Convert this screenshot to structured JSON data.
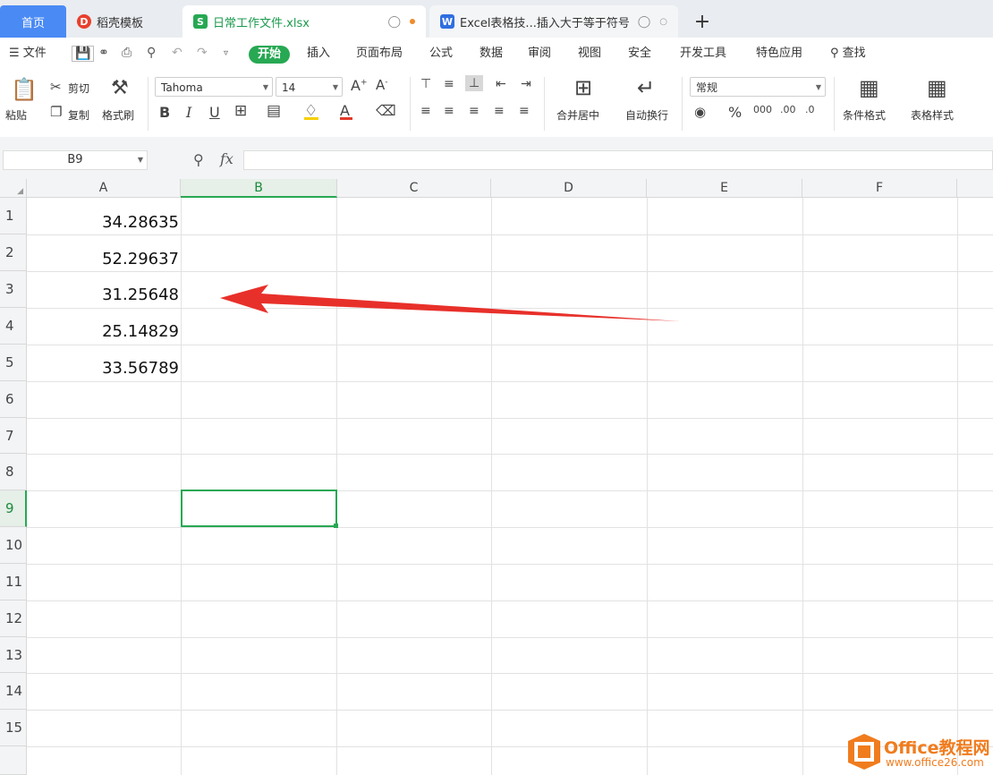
{
  "tabs": {
    "home": "首页",
    "templates": "稻壳模板",
    "doc1": "日常工作文件.xlsx",
    "doc2": "Excel表格技...插入大于等于符号",
    "add": "+"
  },
  "menu": {
    "file": "文件",
    "items": [
      "开始",
      "插入",
      "页面布局",
      "公式",
      "数据",
      "审阅",
      "视图",
      "安全",
      "开发工具",
      "特色应用"
    ],
    "search": "查找"
  },
  "ribbon": {
    "paste": "粘贴",
    "cut": "剪切",
    "copy": "复制",
    "format_painter": "格式刷",
    "font_name": "Tahoma",
    "font_size": "14",
    "merge_center": "合并居中",
    "wrap_text": "自动换行",
    "number_format": "常规",
    "cond_format": "条件格式",
    "table_style": "表格样式"
  },
  "formula_bar": {
    "name_box": "B9",
    "fx": "fx",
    "value": ""
  },
  "sheet": {
    "columns": [
      "A",
      "B",
      "C",
      "D",
      "E",
      "F"
    ],
    "selected_column": "B",
    "rows": [
      "1",
      "2",
      "3",
      "4",
      "5",
      "6",
      "7",
      "8",
      "9",
      "10",
      "11",
      "12",
      "13",
      "14",
      "15"
    ],
    "selected_row": "9",
    "column_a_values": [
      "34.28635",
      "52.29637",
      "31.25648",
      "25.14829",
      "33.56789"
    ],
    "selected_cell": "B9"
  },
  "annotation": {
    "arrow_color": "#e8302a",
    "points_to_row": "3"
  },
  "watermark": {
    "brand": "Office教程网",
    "url": "www.office26.com",
    "color": "#f07c1e"
  },
  "colors": {
    "accent": "#27a853",
    "home_tab": "#4a8af4"
  }
}
